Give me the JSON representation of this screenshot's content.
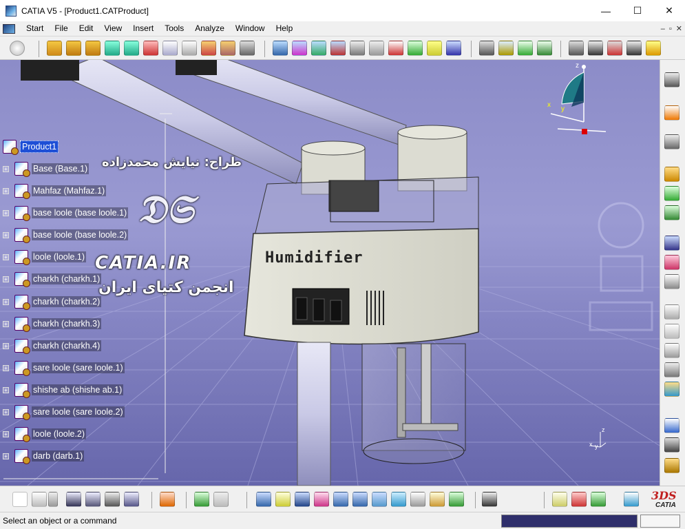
{
  "window": {
    "title": "CATIA V5 - [Product1.CATProduct]",
    "minimize": "—",
    "maximize": "☐",
    "close": "✕"
  },
  "menu": {
    "items": [
      {
        "label": "Start"
      },
      {
        "label": "File"
      },
      {
        "label": "Edit"
      },
      {
        "label": "View"
      },
      {
        "label": "Insert"
      },
      {
        "label": "Tools"
      },
      {
        "label": "Analyze"
      },
      {
        "label": "Window"
      },
      {
        "label": "Help"
      }
    ],
    "mdi_min": "–",
    "mdi_restore": "▫",
    "mdi_close": "✕"
  },
  "tree": {
    "root": "Product1",
    "nodes": [
      {
        "label": "Base (Base.1)"
      },
      {
        "label": "Mahfaz (Mahfaz.1)"
      },
      {
        "label": "base loole (base loole.1)"
      },
      {
        "label": "base loole (base loole.2)"
      },
      {
        "label": "loole (loole.1)"
      },
      {
        "label": "charkh (charkh.1)"
      },
      {
        "label": "charkh (charkh.2)"
      },
      {
        "label": "charkh (charkh.3)"
      },
      {
        "label": "charkh (charkh.4)"
      },
      {
        "label": "sare loole (sare loole.1)"
      },
      {
        "label": "shishe ab (shishe ab.1)"
      },
      {
        "label": "sare loole (sare loole.2)"
      },
      {
        "label": "loole (loole.2)"
      },
      {
        "label": "darb (darb.1)"
      }
    ]
  },
  "watermark": {
    "designer": "طراح: نیایش محمدزاده",
    "site": "CATIA.IR",
    "society": "انجمن کتیای ایران"
  },
  "model": {
    "label": "Humidifier"
  },
  "compass": {
    "x": "x",
    "y": "y",
    "z": "z"
  },
  "mini_axis": {
    "x": "x",
    "y": "y",
    "z": "z"
  },
  "brand": {
    "logo": "CATIA"
  },
  "status": {
    "message": "Select an object or a command"
  },
  "colors": {
    "accent": "#1e4fd6",
    "viewport_top": "#8c8cc8",
    "viewport_bottom": "#6e6eb0"
  }
}
